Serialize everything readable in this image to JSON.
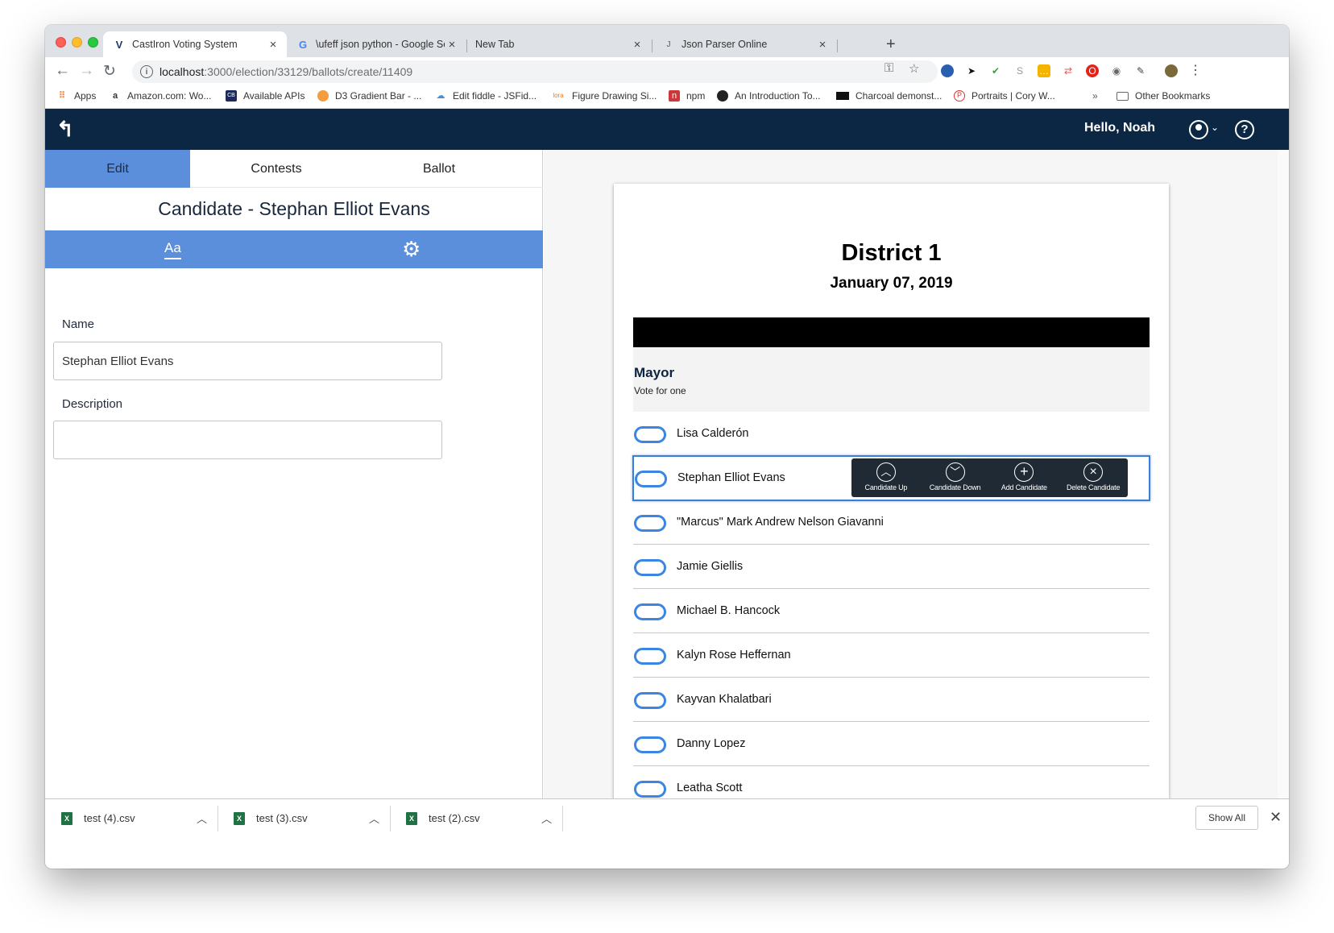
{
  "browser": {
    "tabs": [
      {
        "title": "CastIron Voting System",
        "icon": "V"
      },
      {
        "title": "\\ufeff json python - Google Sea",
        "icon": "G"
      },
      {
        "title": "New Tab",
        "icon": ""
      },
      {
        "title": "Json Parser Online",
        "icon": "J"
      }
    ],
    "url_host": "localhost",
    "url_path": ":3000/election/33129/ballots/create/11409",
    "bookmarks": [
      {
        "label": "Apps",
        "icon": "apps-grid-icon"
      },
      {
        "label": "Amazon.com: Wo...",
        "icon": "amazon-icon"
      },
      {
        "label": "Available APIs",
        "icon": "cb-icon"
      },
      {
        "label": "D3 Gradient Bar - ...",
        "icon": "d3-icon"
      },
      {
        "label": "Edit fiddle - JSFid...",
        "icon": "jsfiddle-icon"
      },
      {
        "label": "Figure Drawing Si...",
        "icon": "line-of-action-icon"
      },
      {
        "label": "npm",
        "icon": "npm-icon"
      },
      {
        "label": "An Introduction To...",
        "icon": "github-icon"
      },
      {
        "label": "Charcoal demonst...",
        "icon": "video-icon"
      },
      {
        "label": "Portraits | Cory W...",
        "icon": "portrait-icon"
      }
    ],
    "bookmarks_overflow": "»",
    "other_bookmarks": "Other Bookmarks"
  },
  "app": {
    "greeting": "Hello, Noah"
  },
  "editor": {
    "tabs": [
      "Edit",
      "Contests",
      "Ballot"
    ],
    "title": "Candidate - Stephan Elliot Evans",
    "text_tool_label": "Aa",
    "name_label": "Name",
    "name_value": "Stephan Elliot Evans",
    "description_label": "Description",
    "description_value": ""
  },
  "ballot": {
    "title": "District 1",
    "date": "January 07, 2019",
    "contest": {
      "name": "Mayor",
      "rule": "Vote for one"
    },
    "candidates": [
      "Lisa Calderón",
      "Stephan Elliot Evans",
      "\"Marcus\" Mark Andrew Nelson Giavanni",
      "Jamie Giellis",
      "Michael B. Hancock",
      "Kalyn Rose Heffernan",
      "Kayvan Khalatbari",
      "Danny Lopez",
      "Leatha Scott"
    ],
    "selected_index": 1,
    "toolbar": {
      "up": "Candidate Up",
      "down": "Candidate Down",
      "add": "Add Candidate",
      "delete": "Delete Candidate"
    }
  },
  "downloads": {
    "files": [
      "test (4).csv",
      "test (3).csv",
      "test (2).csv"
    ],
    "show_all": "Show All"
  },
  "colors": {
    "header_bg": "#0b2744",
    "accent_blue": "#5b8fdc",
    "oval_blue": "#3a86e0",
    "toolbar_dark": "#1f2a35"
  }
}
